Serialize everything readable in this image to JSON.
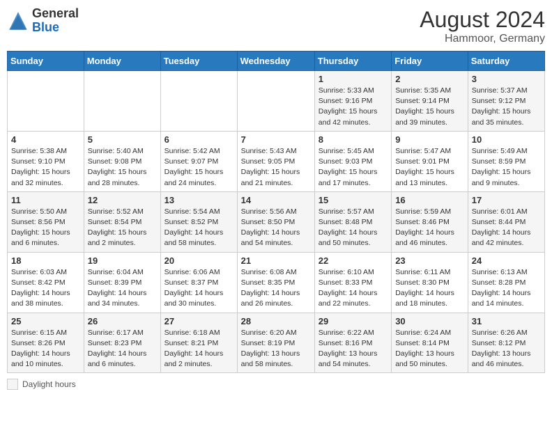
{
  "header": {
    "logo_general": "General",
    "logo_blue": "Blue",
    "month_year": "August 2024",
    "location": "Hammoor, Germany"
  },
  "days_of_week": [
    "Sunday",
    "Monday",
    "Tuesday",
    "Wednesday",
    "Thursday",
    "Friday",
    "Saturday"
  ],
  "legend": {
    "label": "Daylight hours"
  },
  "weeks": [
    [
      {
        "day": "",
        "info": ""
      },
      {
        "day": "",
        "info": ""
      },
      {
        "day": "",
        "info": ""
      },
      {
        "day": "",
        "info": ""
      },
      {
        "day": "1",
        "info": "Sunrise: 5:33 AM\nSunset: 9:16 PM\nDaylight: 15 hours\nand 42 minutes."
      },
      {
        "day": "2",
        "info": "Sunrise: 5:35 AM\nSunset: 9:14 PM\nDaylight: 15 hours\nand 39 minutes."
      },
      {
        "day": "3",
        "info": "Sunrise: 5:37 AM\nSunset: 9:12 PM\nDaylight: 15 hours\nand 35 minutes."
      }
    ],
    [
      {
        "day": "4",
        "info": "Sunrise: 5:38 AM\nSunset: 9:10 PM\nDaylight: 15 hours\nand 32 minutes."
      },
      {
        "day": "5",
        "info": "Sunrise: 5:40 AM\nSunset: 9:08 PM\nDaylight: 15 hours\nand 28 minutes."
      },
      {
        "day": "6",
        "info": "Sunrise: 5:42 AM\nSunset: 9:07 PM\nDaylight: 15 hours\nand 24 minutes."
      },
      {
        "day": "7",
        "info": "Sunrise: 5:43 AM\nSunset: 9:05 PM\nDaylight: 15 hours\nand 21 minutes."
      },
      {
        "day": "8",
        "info": "Sunrise: 5:45 AM\nSunset: 9:03 PM\nDaylight: 15 hours\nand 17 minutes."
      },
      {
        "day": "9",
        "info": "Sunrise: 5:47 AM\nSunset: 9:01 PM\nDaylight: 15 hours\nand 13 minutes."
      },
      {
        "day": "10",
        "info": "Sunrise: 5:49 AM\nSunset: 8:59 PM\nDaylight: 15 hours\nand 9 minutes."
      }
    ],
    [
      {
        "day": "11",
        "info": "Sunrise: 5:50 AM\nSunset: 8:56 PM\nDaylight: 15 hours\nand 6 minutes."
      },
      {
        "day": "12",
        "info": "Sunrise: 5:52 AM\nSunset: 8:54 PM\nDaylight: 15 hours\nand 2 minutes."
      },
      {
        "day": "13",
        "info": "Sunrise: 5:54 AM\nSunset: 8:52 PM\nDaylight: 14 hours\nand 58 minutes."
      },
      {
        "day": "14",
        "info": "Sunrise: 5:56 AM\nSunset: 8:50 PM\nDaylight: 14 hours\nand 54 minutes."
      },
      {
        "day": "15",
        "info": "Sunrise: 5:57 AM\nSunset: 8:48 PM\nDaylight: 14 hours\nand 50 minutes."
      },
      {
        "day": "16",
        "info": "Sunrise: 5:59 AM\nSunset: 8:46 PM\nDaylight: 14 hours\nand 46 minutes."
      },
      {
        "day": "17",
        "info": "Sunrise: 6:01 AM\nSunset: 8:44 PM\nDaylight: 14 hours\nand 42 minutes."
      }
    ],
    [
      {
        "day": "18",
        "info": "Sunrise: 6:03 AM\nSunset: 8:42 PM\nDaylight: 14 hours\nand 38 minutes."
      },
      {
        "day": "19",
        "info": "Sunrise: 6:04 AM\nSunset: 8:39 PM\nDaylight: 14 hours\nand 34 minutes."
      },
      {
        "day": "20",
        "info": "Sunrise: 6:06 AM\nSunset: 8:37 PM\nDaylight: 14 hours\nand 30 minutes."
      },
      {
        "day": "21",
        "info": "Sunrise: 6:08 AM\nSunset: 8:35 PM\nDaylight: 14 hours\nand 26 minutes."
      },
      {
        "day": "22",
        "info": "Sunrise: 6:10 AM\nSunset: 8:33 PM\nDaylight: 14 hours\nand 22 minutes."
      },
      {
        "day": "23",
        "info": "Sunrise: 6:11 AM\nSunset: 8:30 PM\nDaylight: 14 hours\nand 18 minutes."
      },
      {
        "day": "24",
        "info": "Sunrise: 6:13 AM\nSunset: 8:28 PM\nDaylight: 14 hours\nand 14 minutes."
      }
    ],
    [
      {
        "day": "25",
        "info": "Sunrise: 6:15 AM\nSunset: 8:26 PM\nDaylight: 14 hours\nand 10 minutes."
      },
      {
        "day": "26",
        "info": "Sunrise: 6:17 AM\nSunset: 8:23 PM\nDaylight: 14 hours\nand 6 minutes."
      },
      {
        "day": "27",
        "info": "Sunrise: 6:18 AM\nSunset: 8:21 PM\nDaylight: 14 hours\nand 2 minutes."
      },
      {
        "day": "28",
        "info": "Sunrise: 6:20 AM\nSunset: 8:19 PM\nDaylight: 13 hours\nand 58 minutes."
      },
      {
        "day": "29",
        "info": "Sunrise: 6:22 AM\nSunset: 8:16 PM\nDaylight: 13 hours\nand 54 minutes."
      },
      {
        "day": "30",
        "info": "Sunrise: 6:24 AM\nSunset: 8:14 PM\nDaylight: 13 hours\nand 50 minutes."
      },
      {
        "day": "31",
        "info": "Sunrise: 6:26 AM\nSunset: 8:12 PM\nDaylight: 13 hours\nand 46 minutes."
      }
    ]
  ]
}
